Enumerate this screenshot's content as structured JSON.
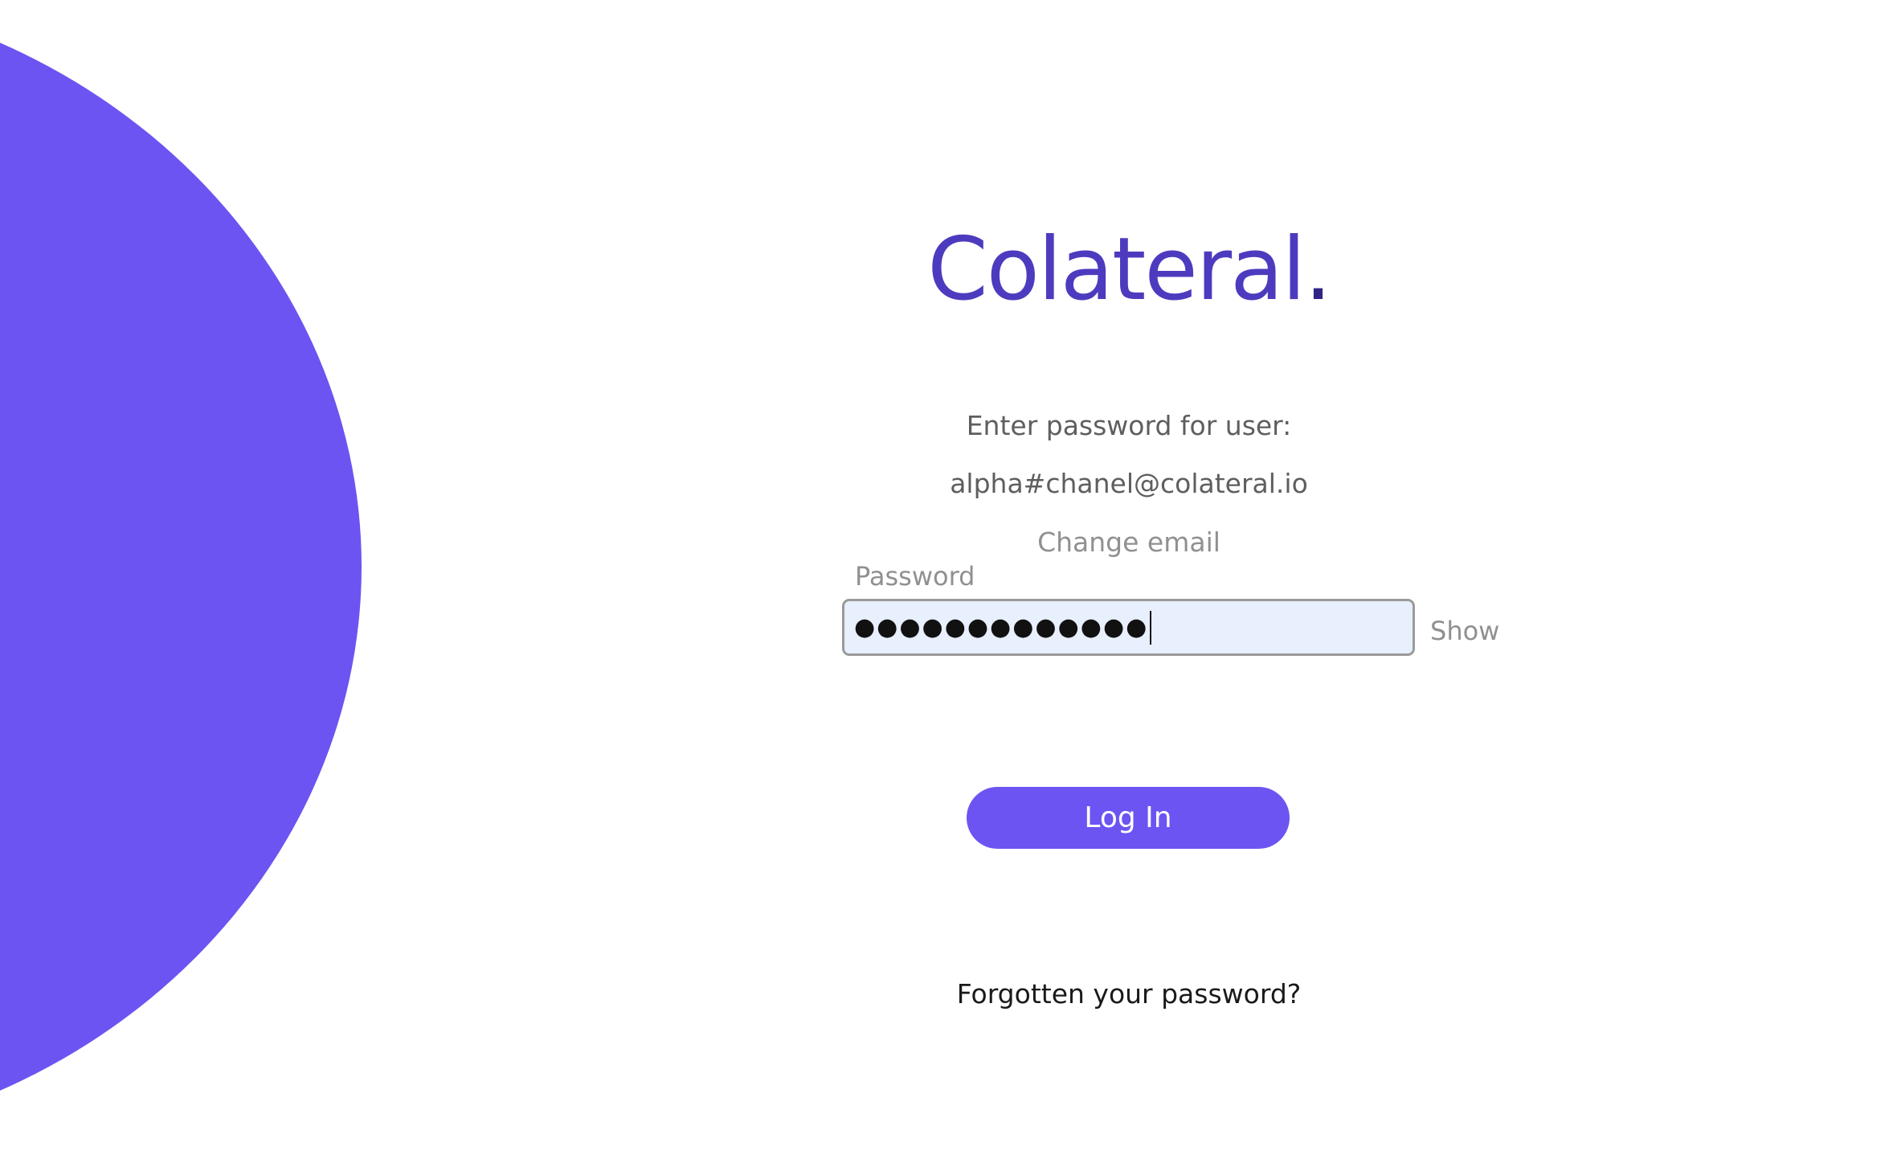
{
  "brand": {
    "logo_text": "Colateral",
    "logo_dot": ".",
    "accent_color": "#6c54f2",
    "logo_color": "#4d3bbf"
  },
  "login": {
    "prompt": "Enter password for user:",
    "user_email": "alpha#chanel@colateral.io",
    "change_email_label": "Change email",
    "password_label": "Password",
    "password_masked": "●●●●●●●●●●●●●",
    "show_label": "Show",
    "submit_label": "Log In",
    "forgot_label": "Forgotten your password?"
  }
}
